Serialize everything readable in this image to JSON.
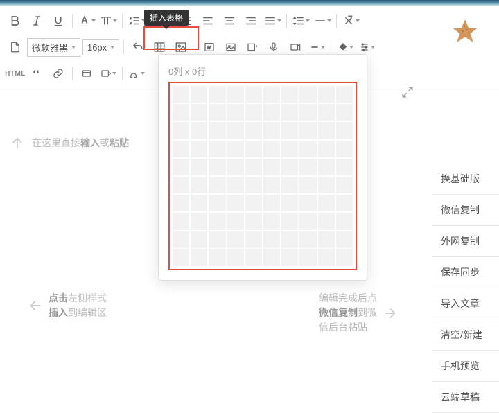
{
  "tooltip": {
    "insert_table": "插入表格"
  },
  "toolbar": {
    "font_family": "微软雅黑",
    "font_size": "16px",
    "html_label": "HTML"
  },
  "table_popup": {
    "label_template": "列 x 行",
    "cols": 0,
    "rows": 0,
    "label": "0列 x 0行",
    "grid_cols": 10,
    "grid_rows": 10
  },
  "editor": {
    "placeholder_pre": "在这里直接",
    "placeholder_bold1": "输入",
    "placeholder_mid": "或",
    "placeholder_bold2": "粘贴"
  },
  "hints": {
    "left_line1_pre": "点击",
    "left_line1_post": "左侧样式",
    "left_line2_pre": "插入",
    "left_line2_post": "到编辑区",
    "right_line1": "编辑完成后点",
    "right_line2_pre": "微信复制",
    "right_line2_post": "到微",
    "right_line3": "信后台粘贴"
  },
  "sidebar": {
    "items": [
      {
        "label": "换基础版"
      },
      {
        "label": "微信复制"
      },
      {
        "label": "外网复制"
      },
      {
        "label": "保存同步"
      },
      {
        "label": "导入文章"
      },
      {
        "label": "清空/新建"
      },
      {
        "label": "手机预览"
      },
      {
        "label": "云端草稿"
      }
    ]
  }
}
